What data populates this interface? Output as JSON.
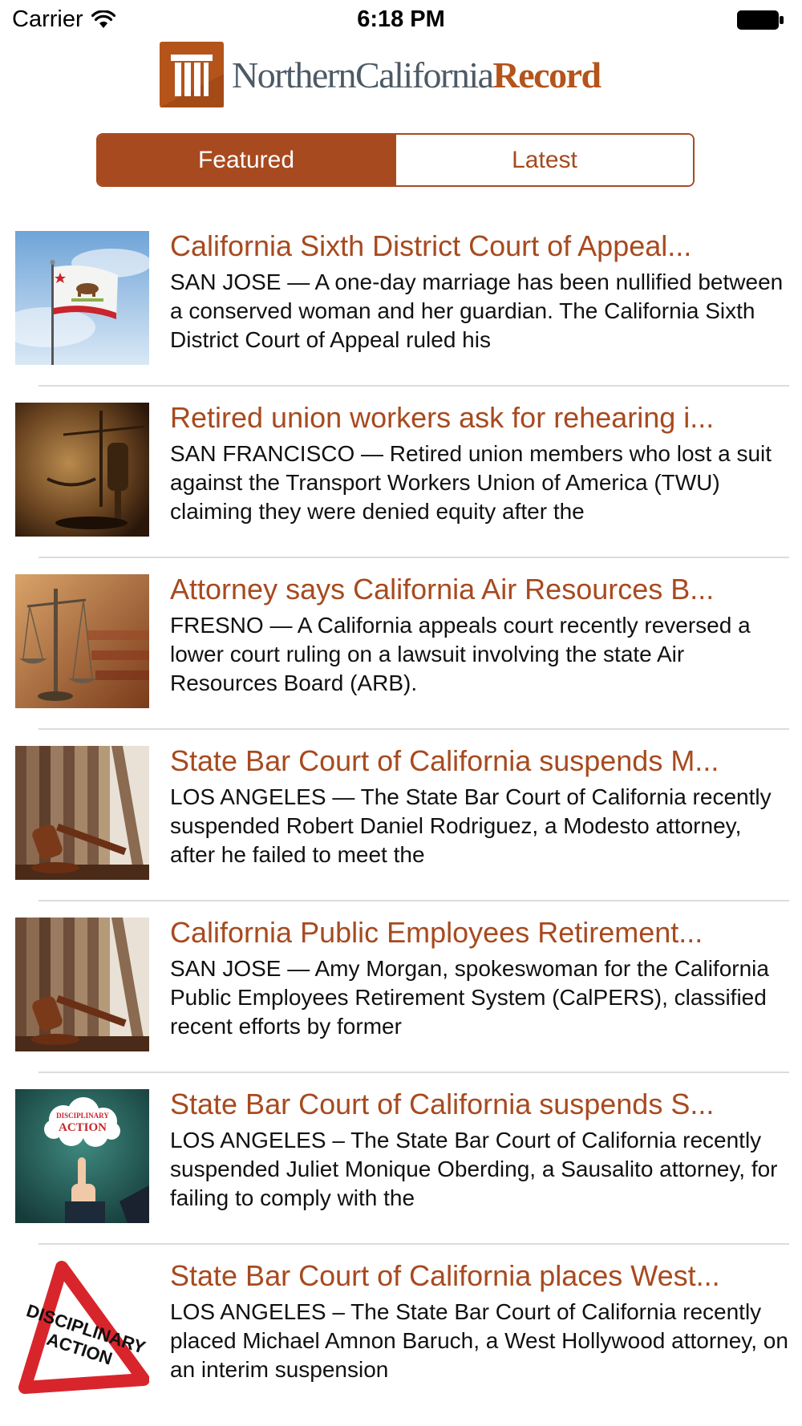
{
  "status_bar": {
    "carrier": "Carrier",
    "time": "6:18 PM"
  },
  "header": {
    "logo_regular": "NorthernCalifornia",
    "logo_bold": "Record"
  },
  "tabs": [
    {
      "label": "Featured",
      "active": true
    },
    {
      "label": "Latest",
      "active": false
    }
  ],
  "articles": [
    {
      "title": "California Sixth District Court of Appeal...",
      "summary": "SAN JOSE — A one-day marriage has been nullified between a conserved woman and her guardian. The California Sixth District Court of Appeal ruled his",
      "thumbnail": "california-flag-image"
    },
    {
      "title": "Retired union workers ask for rehearing i...",
      "summary": "SAN FRANCISCO — Retired union members who lost a suit against the Transport Workers Union of America (TWU) claiming they were denied equity after the",
      "thumbnail": "scales-and-gavel-image"
    },
    {
      "title": "Attorney says California Air Resources B...",
      "summary": "FRESNO — A California appeals court recently reversed a lower court ruling on a lawsuit involving the state Air Resources Board (ARB).",
      "thumbnail": "scales-of-justice-image"
    },
    {
      "title": "State Bar Court of California suspends M...",
      "summary": "LOS ANGELES — The State Bar Court of California recently suspended Robert Daniel Rodriguez, a Modesto attorney, after he failed to meet the",
      "thumbnail": "gavel-and-books-image"
    },
    {
      "title": "California Public Employees Retirement...",
      "summary": "SAN JOSE — Amy Morgan, spokeswoman for the California Public Employees Retirement System (CalPERS), classified recent efforts by former",
      "thumbnail": "gavel-and-books-image"
    },
    {
      "title": "State Bar Court of California suspends S...",
      "summary": "LOS ANGELES – The State Bar Court of California recently suspended Juliet Monique Oberding, a Sausalito attorney, for failing to comply with the",
      "thumbnail": "disciplinary-action-cloud-image",
      "thumbnail_text": [
        "DISCIPLINARY",
        "ACTION"
      ]
    },
    {
      "title": "State Bar Court of California places West...",
      "summary": "LOS ANGELES – The State Bar Court of California recently placed Michael Amnon Baruch, a West Hollywood attorney, on an interim suspension",
      "thumbnail": "disciplinary-action-sign-image",
      "thumbnail_text": [
        "DISCIPLINARY",
        "ACTION"
      ]
    }
  ],
  "colors": {
    "accent": "#a74a1f",
    "logo_brand": "#b4541b",
    "logo_gray": "#4d5a66",
    "divider": "#dcdcdc"
  }
}
